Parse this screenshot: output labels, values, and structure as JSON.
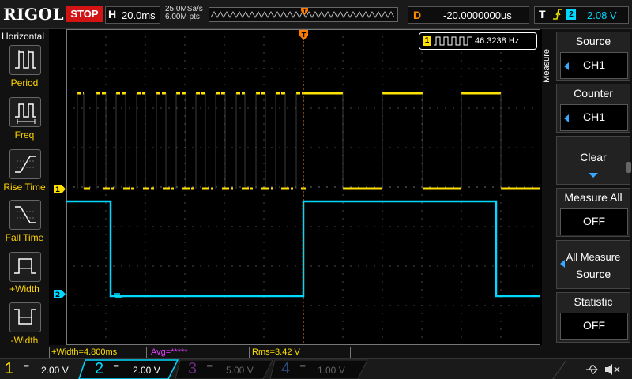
{
  "brand": "RIGOL",
  "run_state": "STOP",
  "horizontal": {
    "label": "H",
    "timebase": "20.0ms"
  },
  "acquisition": {
    "sample_rate": "25.0MSa/s",
    "memory_depth": "6.00M pts"
  },
  "delay": {
    "label": "D",
    "value": "-20.0000000us"
  },
  "trigger": {
    "label": "T",
    "edge_icon": "rising-edge-icon",
    "source_channel": "2",
    "level": "2.08 V"
  },
  "left_menu": {
    "title": "Horizontal",
    "items": [
      {
        "label": "Period",
        "icon": "period-icon"
      },
      {
        "label": "Freq",
        "icon": "freq-icon"
      },
      {
        "label": "Rise Time",
        "icon": "rise-time-icon"
      },
      {
        "label": "Fall Time",
        "icon": "fall-time-icon"
      },
      {
        "label": "+Width",
        "icon": "pos-width-icon"
      },
      {
        "label": "-Width",
        "icon": "neg-width-icon"
      }
    ]
  },
  "measure_readout": {
    "channel": "1",
    "value": "46.3238 Hz"
  },
  "channel_markers": {
    "ch1": "1",
    "ch2": "2",
    "trigger": "T"
  },
  "right_menu": {
    "title": "Measure",
    "source": {
      "title": "Source",
      "value": "CH1"
    },
    "counter": {
      "title": "Counter",
      "value": "CH1"
    },
    "clear": {
      "title": "Clear"
    },
    "measure_all": {
      "title": "Measure All",
      "value": "OFF"
    },
    "all_measure_source": {
      "line1": "All Measure",
      "line2": "Source"
    },
    "statistic": {
      "title": "Statistic",
      "value": "OFF"
    }
  },
  "measurements": [
    {
      "text": "+Width=4.800ms",
      "color": "#ffe000"
    },
    {
      "text": "Avg=*****",
      "color": "#e040ff"
    },
    {
      "text": "Rms=3.42 V",
      "color": "#ffe000"
    }
  ],
  "channels": [
    {
      "num": "1",
      "scale": "2.00 V",
      "color": "#ffe000",
      "active": true
    },
    {
      "num": "2",
      "scale": "2.00 V",
      "color": "#00d8ff",
      "active": true
    },
    {
      "num": "3",
      "scale": "5.00 V",
      "color": "#e040ff",
      "active": false
    },
    {
      "num": "4",
      "scale": "1.00 V",
      "color": "#3aa7ff",
      "active": false
    }
  ],
  "colors": {
    "ch1": "#ffe000",
    "ch2": "#00d8ff",
    "trigger": "#ff7a00",
    "stop": "#d21414"
  }
}
